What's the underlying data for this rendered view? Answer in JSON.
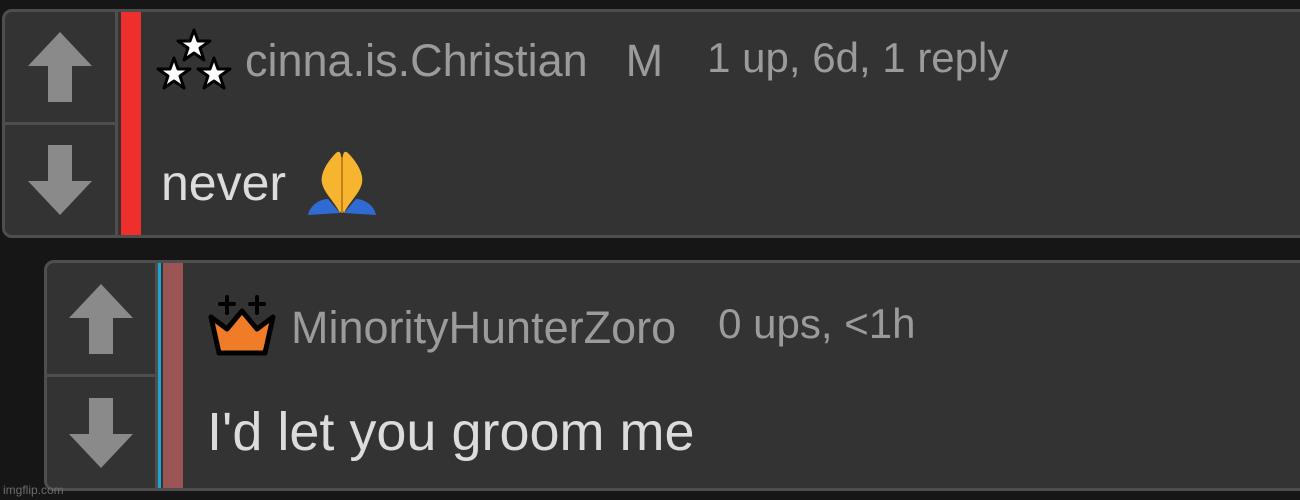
{
  "comments": [
    {
      "username": "cinna.is.Christian",
      "gender": "M",
      "meta": "1 up, 6d, 1 reply",
      "text": "never",
      "badge_icon": "three-stars-icon",
      "text_emoji": "folded-hands-icon",
      "bar_color": "#ee2f2c"
    },
    {
      "username": "MinorityHunterZoro",
      "meta": "0 ups, <1h",
      "text": "I'd let you groom me",
      "badge_icon": "crown-icon",
      "bar_color": "#9c5555",
      "highlight_color": "#1aa7d6"
    }
  ],
  "watermark": "imgflip.com"
}
